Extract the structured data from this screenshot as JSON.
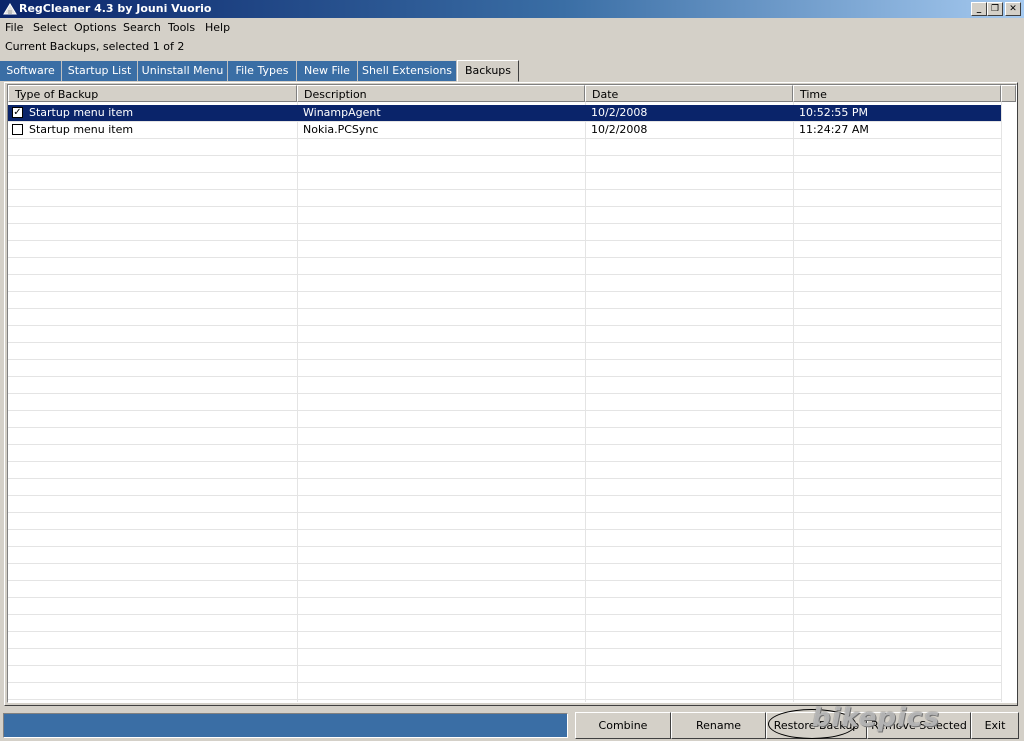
{
  "window": {
    "title": "RegCleaner 4.3 by Jouni Vuorio",
    "controls": {
      "minimize": "_",
      "restore": "❐",
      "close": "✕"
    }
  },
  "menu": [
    "File",
    "Select",
    "Options",
    "Search",
    "Tools",
    "Help"
  ],
  "status_text": "Current Backups, selected 1 of 2",
  "tabs": [
    "Software",
    "Startup List",
    "Uninstall Menu",
    "File Types",
    "New File",
    "Shell Extensions",
    "Backups"
  ],
  "active_tab": "Backups",
  "table": {
    "columns": [
      "Type of Backup",
      "Description",
      "Date",
      "Time"
    ],
    "rows": [
      {
        "checked": true,
        "type": "Startup menu item",
        "description": "WinampAgent",
        "date": "10/2/2008",
        "time": "10:52:55 PM"
      },
      {
        "checked": false,
        "type": "Startup menu item",
        "description": "Nokia.PCSync",
        "date": "10/2/2008",
        "time": "11:24:27 AM"
      }
    ]
  },
  "buttons": {
    "combine": "Combine",
    "rename": "Rename",
    "restore_backup": "Restore Backup",
    "remove_selected": "Remove Selected",
    "exit": "Exit"
  },
  "watermark": "bikepics",
  "colors": {
    "titlebar": "#0a246a",
    "selection": "#0a246a",
    "tab_inactive": "#3a6ea5",
    "face": "#d4d0c8"
  }
}
